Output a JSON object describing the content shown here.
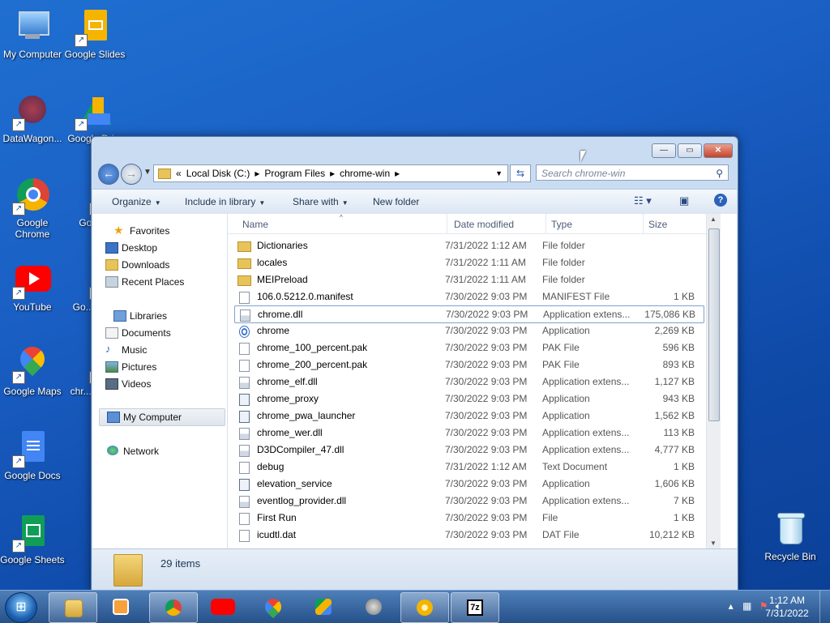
{
  "desktop": {
    "icons": [
      {
        "label": "My Computer",
        "icon": "computer-icon"
      },
      {
        "label": "Google Slides",
        "icon": "google-slides-icon"
      },
      {
        "label": "DataWagon...",
        "icon": "datawagon-icon"
      },
      {
        "label": "Google Dri...",
        "icon": "google-drive-icon"
      },
      {
        "label": "Google Chrome",
        "icon": "chrome-icon"
      },
      {
        "label": "Goog...",
        "icon": "partially-hidden-icon"
      },
      {
        "label": "YouTube",
        "icon": "youtube-icon"
      },
      {
        "label": "Go... Ch...",
        "icon": "partially-hidden-icon"
      },
      {
        "label": "Google Maps",
        "icon": "google-maps-icon"
      },
      {
        "label": "chr... Sho...",
        "icon": "partially-hidden-icon"
      },
      {
        "label": "Google Docs",
        "icon": "google-docs-icon"
      },
      {
        "label": "Google Sheets",
        "icon": "google-sheets-icon"
      },
      {
        "label": "Recycle Bin",
        "icon": "recycle-bin-icon"
      }
    ]
  },
  "explorer": {
    "breadcrumb": {
      "prefix": "«",
      "parts": [
        "Local Disk (C:)",
        "Program Files",
        "chrome-win"
      ]
    },
    "search_placeholder": "Search chrome-win",
    "toolbar": {
      "organize": "Organize",
      "include": "Include in library",
      "share": "Share with",
      "newfolder": "New folder"
    },
    "nav": {
      "favorites": "Favorites",
      "desktop": "Desktop",
      "downloads": "Downloads",
      "recent": "Recent Places",
      "libraries": "Libraries",
      "documents": "Documents",
      "music": "Music",
      "pictures": "Pictures",
      "videos": "Videos",
      "mycomputer": "My Computer",
      "network": "Network"
    },
    "columns": {
      "name": "Name",
      "date": "Date modified",
      "type": "Type",
      "size": "Size"
    },
    "files": [
      {
        "name": "Dictionaries",
        "date": "7/31/2022 1:12 AM",
        "type": "File folder",
        "size": "",
        "icon": "folder"
      },
      {
        "name": "locales",
        "date": "7/31/2022 1:11 AM",
        "type": "File folder",
        "size": "",
        "icon": "folder"
      },
      {
        "name": "MEIPreload",
        "date": "7/31/2022 1:11 AM",
        "type": "File folder",
        "size": "",
        "icon": "folder"
      },
      {
        "name": "106.0.5212.0.manifest",
        "date": "7/30/2022 9:03 PM",
        "type": "MANIFEST File",
        "size": "1 KB",
        "icon": "file"
      },
      {
        "name": "chrome.dll",
        "date": "7/30/2022 9:03 PM",
        "type": "Application extens...",
        "size": "175,086 KB",
        "icon": "dll"
      },
      {
        "name": "chrome",
        "date": "7/30/2022 9:03 PM",
        "type": "Application",
        "size": "2,269 KB",
        "icon": "chrome"
      },
      {
        "name": "chrome_100_percent.pak",
        "date": "7/30/2022 9:03 PM",
        "type": "PAK File",
        "size": "596 KB",
        "icon": "file"
      },
      {
        "name": "chrome_200_percent.pak",
        "date": "7/30/2022 9:03 PM",
        "type": "PAK File",
        "size": "893 KB",
        "icon": "file"
      },
      {
        "name": "chrome_elf.dll",
        "date": "7/30/2022 9:03 PM",
        "type": "Application extens...",
        "size": "1,127 KB",
        "icon": "dll"
      },
      {
        "name": "chrome_proxy",
        "date": "7/30/2022 9:03 PM",
        "type": "Application",
        "size": "943 KB",
        "icon": "app"
      },
      {
        "name": "chrome_pwa_launcher",
        "date": "7/30/2022 9:03 PM",
        "type": "Application",
        "size": "1,562 KB",
        "icon": "app"
      },
      {
        "name": "chrome_wer.dll",
        "date": "7/30/2022 9:03 PM",
        "type": "Application extens...",
        "size": "113 KB",
        "icon": "dll"
      },
      {
        "name": "D3DCompiler_47.dll",
        "date": "7/30/2022 9:03 PM",
        "type": "Application extens...",
        "size": "4,777 KB",
        "icon": "dll"
      },
      {
        "name": "debug",
        "date": "7/31/2022 1:12 AM",
        "type": "Text Document",
        "size": "1 KB",
        "icon": "file"
      },
      {
        "name": "elevation_service",
        "date": "7/30/2022 9:03 PM",
        "type": "Application",
        "size": "1,606 KB",
        "icon": "app"
      },
      {
        "name": "eventlog_provider.dll",
        "date": "7/30/2022 9:03 PM",
        "type": "Application extens...",
        "size": "7 KB",
        "icon": "dll"
      },
      {
        "name": "First Run",
        "date": "7/30/2022 9:03 PM",
        "type": "File",
        "size": "1 KB",
        "icon": "file"
      },
      {
        "name": "icudtl.dat",
        "date": "7/30/2022 9:03 PM",
        "type": "DAT File",
        "size": "10,212 KB",
        "icon": "file"
      }
    ],
    "selected_row": 4,
    "status": {
      "count": "29 items"
    }
  },
  "taskbar": {
    "clock_time": "1:12 AM",
    "clock_date": "7/31/2022",
    "apps": [
      "explorer-icon",
      "media-player-icon",
      "chrome-icon",
      "youtube-icon",
      "google-maps-icon",
      "google-drive-icon",
      "google-earth-pro-icon",
      "chrome-canary-icon",
      "7zip-icon"
    ]
  },
  "colors": {
    "accent": "#2b63b8",
    "selection_border": "#7da2ce"
  }
}
